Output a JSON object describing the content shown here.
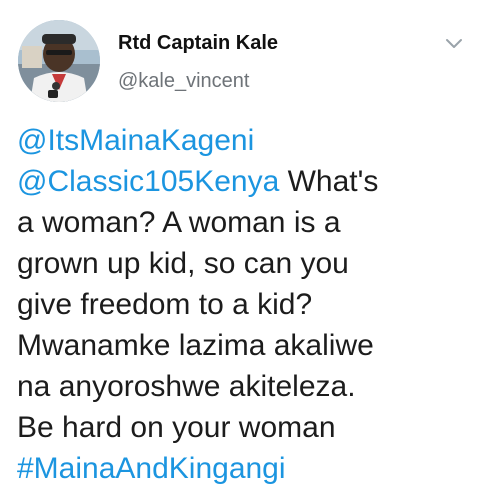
{
  "author": {
    "name": "Rtd Captain Kale",
    "handle": "@kale_vincent"
  },
  "icons": {
    "menu": "chevron-down-icon",
    "avatar": "profile-photo"
  },
  "colors": {
    "link": "#1b95e0",
    "text": "#1c1c1c",
    "secondary": "#6e7378"
  },
  "tweet": {
    "mention_1": "@ItsMainaKageni",
    "mention_2": "@Classic105Kenya",
    "line_2_rest": " What's",
    "line_3": "a woman? A woman is a",
    "line_4": "grown up kid, so can you",
    "line_5": "give freedom to a kid?",
    "line_6": "Mwanamke lazima akaliwe",
    "line_7": "na anyoroshwe akiteleza.",
    "line_8": "Be hard on your woman",
    "hashtag": "#MainaAndKingangi"
  }
}
